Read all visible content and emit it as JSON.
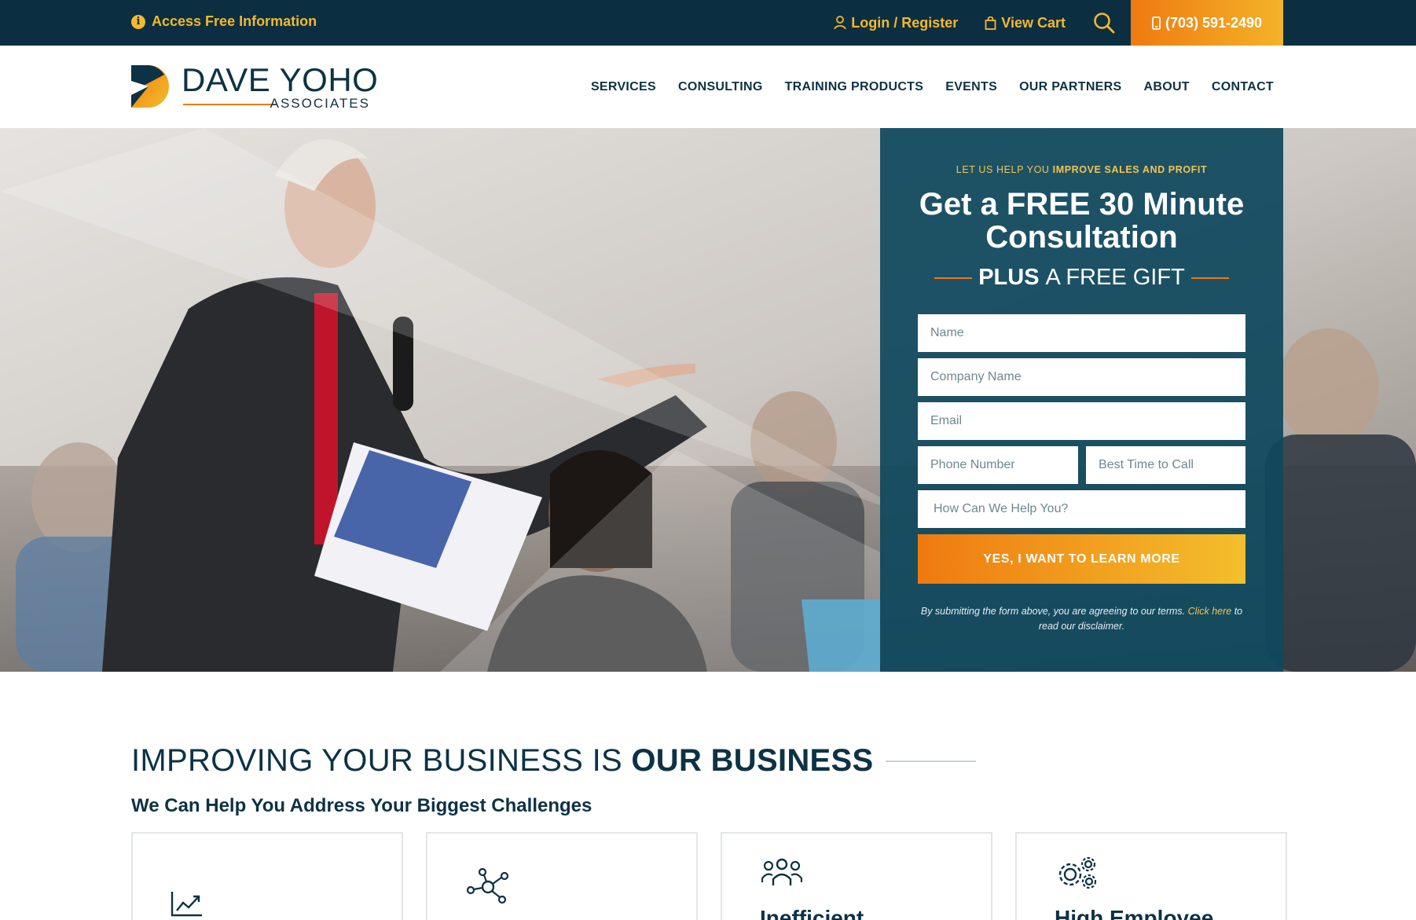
{
  "topbar": {
    "info_label": "Access Free Information",
    "login_label": "Login / Register",
    "cart_label": "View Cart",
    "phone_label": "(703) 591-2490"
  },
  "header": {
    "logo_brand": "DAVE YOHO",
    "logo_sub": "ASSOCIATES",
    "nav": [
      "SERVICES",
      "CONSULTING",
      "TRAINING PRODUCTS",
      "EVENTS",
      "OUR PARTNERS",
      "ABOUT",
      "CONTACT"
    ]
  },
  "form": {
    "eyebrow_plain": "LET US HELP YOU ",
    "eyebrow_bold": "IMPROVE SALES AND PROFIT",
    "headline": "Get a FREE 30 Minute Consultation",
    "gift_bold": "PLUS",
    "gift_rest": "A FREE GIFT",
    "placeholders": {
      "name": "Name",
      "company": "Company Name",
      "email": "Email",
      "phone": "Phone Number",
      "best_time": "Best Time to Call",
      "help": "How Can We Help You?"
    },
    "submit_label": "YES, I WANT TO LEARN MORE",
    "disclaimer_before": "By submitting the form above, you are agreeing to our terms. ",
    "disclaimer_link": "Click here",
    "disclaimer_after": " to read our disclaimer."
  },
  "section": {
    "title_plain": "IMPROVING YOUR BUSINESS IS ",
    "title_bold": "OUR BUSINESS",
    "subhead": "We Can Help You Address Your Biggest Challenges",
    "cards": [
      {
        "title": "",
        "icon": "trending-up-icon"
      },
      {
        "title": "",
        "icon": "network-nodes-icon"
      },
      {
        "title": "Inefficient",
        "icon": "team-group-icon"
      },
      {
        "title": "High Employee",
        "icon": "gears-icon"
      }
    ]
  },
  "colors": {
    "navy": "#0b2f40",
    "accent_orange": "#ef7a10",
    "accent_gold": "#f5b82e",
    "panel_teal": "#0f485e"
  }
}
